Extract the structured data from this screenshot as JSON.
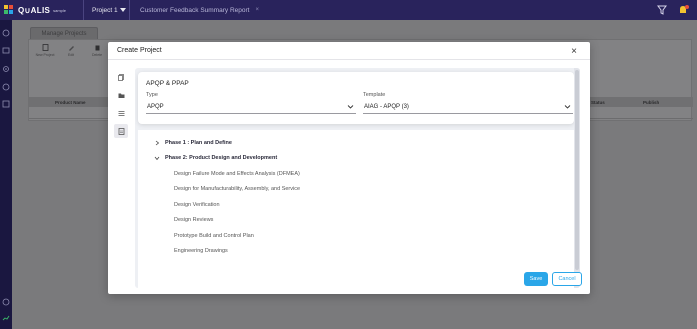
{
  "header": {
    "logo_text": "Q∪ALIS",
    "logo_sub": "sample",
    "project_label": "Project 1",
    "report_tab": "Customer Feedback Summary Report",
    "report_tab_close": "×"
  },
  "app": {
    "tab_label": "Manage Projects",
    "toolbar": [
      {
        "label": "New Project",
        "icon": "new-document-icon"
      },
      {
        "label": "Edit",
        "icon": "edit-icon"
      },
      {
        "label": "Delete",
        "icon": "delete-icon"
      }
    ],
    "grid_columns": [
      "Product Name",
      "Status",
      "Publish"
    ]
  },
  "modal": {
    "title": "Create Project",
    "close_label": "×",
    "card_title": "APQP & PPAP",
    "type_label": "Type",
    "type_value": "APQP",
    "template_label": "Template",
    "template_value": "AIAG - APQP (3)",
    "phases": [
      {
        "label": "Phase 1 : Plan and Define",
        "expanded": false,
        "children": []
      },
      {
        "label": "Phase 2: Product Design and Development",
        "expanded": true,
        "children": [
          "Design Failure Mode and Effects Analysis (DFMEA)",
          "Design for Manufacturability, Assembly, and Service",
          "Design Verification",
          "Design Reviews",
          "Prototype Build and Control Plan",
          "Engineering Drawings"
        ]
      }
    ],
    "save_label": "Save",
    "cancel_label": "Cancel"
  },
  "colors": {
    "topbar": "#29235c",
    "primary": "#2aa6e8",
    "overlay": "#7e7e80"
  }
}
